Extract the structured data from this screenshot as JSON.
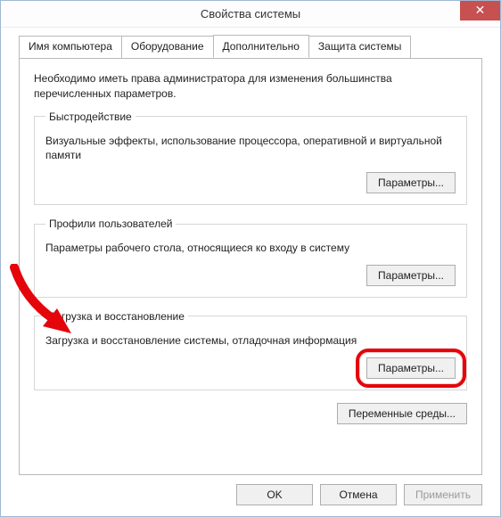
{
  "window": {
    "title": "Свойства системы",
    "close_label": "✕"
  },
  "tabs": [
    {
      "label": "Имя компьютера"
    },
    {
      "label": "Оборудование"
    },
    {
      "label": "Дополнительно"
    },
    {
      "label": "Защита системы"
    }
  ],
  "active_tab_index": 2,
  "intro": "Необходимо иметь права администратора для изменения большинства перечисленных параметров.",
  "groups": {
    "performance": {
      "legend": "Быстродействие",
      "desc": "Визуальные эффекты, использование процессора, оперативной и виртуальной памяти",
      "button": "Параметры..."
    },
    "profiles": {
      "legend": "Профили пользователей",
      "desc": "Параметры рабочего стола, относящиеся ко входу в систему",
      "button": "Параметры..."
    },
    "startup": {
      "legend": "Загрузка и восстановление",
      "desc": "Загрузка и восстановление системы, отладочная информация",
      "button": "Параметры..."
    }
  },
  "env_button": "Переменные среды...",
  "dialog_buttons": {
    "ok": "OK",
    "cancel": "Отмена",
    "apply": "Применить"
  }
}
